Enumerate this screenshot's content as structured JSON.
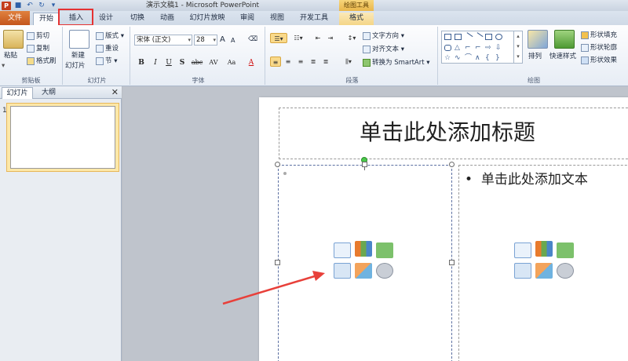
{
  "window": {
    "title": "演示文稿1 - Microsoft PowerPoint",
    "context_tab_header": "绘图工具"
  },
  "tabs": [
    "文件",
    "开始",
    "插入",
    "设计",
    "切换",
    "动画",
    "幻灯片放映",
    "审阅",
    "视图",
    "开发工具",
    "格式"
  ],
  "active_tab": "开始",
  "highlighted_tab": "插入",
  "ribbon": {
    "clipboard": {
      "label": "剪贴板",
      "paste": "粘贴",
      "cut": "剪切",
      "copy": "复制",
      "format_painter": "格式刷"
    },
    "slides": {
      "label": "幻灯片",
      "new_slide_1": "新建",
      "new_slide_2": "幻灯片",
      "layout": "版式",
      "reset": "重设",
      "section": "节"
    },
    "font": {
      "label": "字体",
      "name": "宋体 (正文)",
      "size": "28",
      "bold": "B",
      "italic": "I",
      "underline": "U",
      "shadow": "S",
      "strike": "abc",
      "spacing": "AV",
      "case": "Aa",
      "color": "A",
      "grow": "A",
      "shrink": "A"
    },
    "paragraph": {
      "label": "段落",
      "text_direction": "文字方向",
      "align_text": "对齐文本",
      "smartart": "转换为 SmartArt"
    },
    "drawing": {
      "label": "绘图",
      "arrange": "排列",
      "quick_styles": "快速样式",
      "shape_fill": "形状填充",
      "shape_outline": "形状轮廓",
      "shape_effects": "形状效果"
    }
  },
  "left_pane": {
    "tab_slides": "幻灯片",
    "tab_outline": "大纲",
    "slide_number": "1"
  },
  "slide": {
    "title_placeholder": "单击此处添加标题",
    "text_placeholder": "单击此处添加文本",
    "bullet": "•"
  },
  "colors": {
    "file_tab": "#c4561c",
    "highlight_box": "#e53232",
    "arrow": "#e8403a",
    "selection_thumb": "#fde8a8"
  }
}
